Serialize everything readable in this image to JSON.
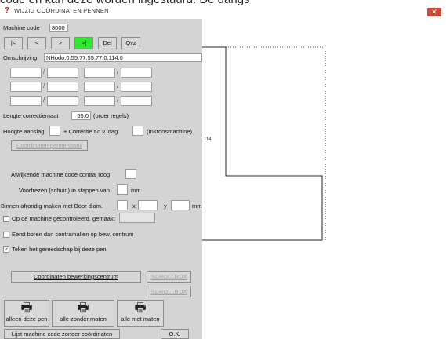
{
  "top_caption": "code en kan deze worden ingestuurd. De dangs",
  "window": {
    "title": "WIJZIG COÖRDINATEN PENNEN"
  },
  "form": {
    "machine_code_label": "Machine code",
    "machine_code_value": "8000",
    "nav_buttons": [
      "|<",
      "<",
      ">",
      ">|"
    ],
    "del_label": "Del",
    "qvz_label": "Qvz",
    "omschrijving_label": "Omschrijving",
    "omschrijving_value": "NHodo:0,55,77,55,77,0,114,0",
    "slash": "/",
    "lengte_label": "Lengte correctiemaat",
    "lengte_value": "55.0",
    "lengte_suffix": "(order regels)",
    "hoogte_label": "Hoogte aanslag",
    "correctie_label": "+ Correctie t.o.v. dag",
    "inkroos_label": "(Inkroosmachine)",
    "coord_penbank_label": "Coordinaten pennenbank",
    "afwijkende_label": "Afwijkende machine code contra Toog",
    "voorfrezen_label": "Voorfrezen (schuin) in stappen van",
    "mm": "mm",
    "binnen_label": "Binnen afrondig maken met Boor diam.",
    "x_label": "x",
    "y_label": "y",
    "checks": [
      {
        "label": "Op de machine gecontroleerd, gemaakt",
        "checked": false
      },
      {
        "label": "Eerst boren dan contramallen op bew. centrum",
        "checked": false
      },
      {
        "label": "Teken het gereedschap bij deze pen",
        "checked": true
      }
    ],
    "coord_bewerk_label": "Coordinaten bewerkingscentrum",
    "scrollbox_label": "SCROLLBOX",
    "print_buttons": [
      "alleen deze pen",
      "alle zonder maten",
      "alle met maten"
    ],
    "lijst_label": "Lijst machine code zonder coördinaten",
    "ok_label": "O.K."
  },
  "drawing": {
    "dimension_label": "114"
  },
  "colors": {
    "panel": "#d4d4d4",
    "active_nav": "#2fe82f",
    "close": "#c4493b"
  }
}
